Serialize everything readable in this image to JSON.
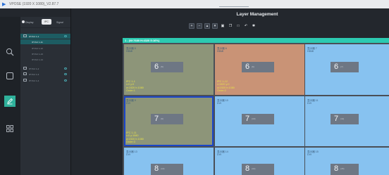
{
  "window": {
    "title": "VPOSE (1920 X 1080)_V2.87.7"
  },
  "header": {
    "mode_labels": [
      "Display",
      "IPC",
      "Signal"
    ]
  },
  "tree": {
    "items": [
      {
        "label": "IP Port 1-1",
        "level": 0,
        "selected": true
      },
      {
        "label": "IP Port 1-11",
        "level": 1,
        "selected": true
      },
      {
        "label": "IP Port 1-12",
        "level": 1,
        "selected": false
      },
      {
        "label": "IP Port 1-13",
        "level": 1,
        "selected": false
      },
      {
        "label": "IP Port 1-14",
        "level": 1,
        "selected": false
      },
      {
        "label": "IP Port 1-2",
        "level": 0,
        "selected": false
      },
      {
        "label": "IP Port 1-3",
        "level": 0,
        "selected": false
      },
      {
        "label": "IP Port 1-4",
        "level": 0,
        "selected": false
      }
    ]
  },
  "main": {
    "title": "Layer Management",
    "toolbar": [
      "plus-icon",
      "minus-icon",
      "layer-up-icon",
      "layer-down-icon",
      "fit-icon",
      "copy-icon",
      "paste-icon",
      "undo-icon",
      "settings-icon"
    ],
    "canvas_header": "1 - (W:7680 H:4320 5:16%)",
    "cells": [
      {
        "name": "显示器 5",
        "port": "HDMI",
        "number": "6",
        "sub": "(5)",
        "bg": "#8d9579",
        "info": [
          "IPC 1-1",
          "x:0 y:0",
          "w:1920 h:1080",
          "Order:1"
        ]
      },
      {
        "name": "显示器 6",
        "port": "HDMI",
        "number": "6",
        "sub": "(6)",
        "bg": "#c99376",
        "info": [
          "IPC 1-12",
          "x:1920 y:0",
          "w:1920 h:1080",
          "Order:2"
        ]
      },
      {
        "name": "显示器 7",
        "port": "HDMI",
        "number": "6",
        "sub": "(7)",
        "bg": "#87c2f0",
        "info": []
      },
      {
        "name": "显示器 9",
        "port": "DVI",
        "number": "7",
        "sub": "(9)",
        "bg": "#8d9579",
        "info": [
          "IPC 1-11",
          "x:0 y:1080",
          "w:1920 h:1080",
          "Order:3"
        ]
      },
      {
        "name": "显示器 10",
        "port": "DVI",
        "number": "7",
        "sub": "(10)",
        "bg": "#87c2f0",
        "info": []
      },
      {
        "name": "显示器 11",
        "port": "DVI",
        "number": "7",
        "sub": "(11)",
        "bg": "#87c2f0",
        "info": []
      },
      {
        "name": "显示器 13",
        "port": "DVI",
        "number": "8",
        "sub": "(13)",
        "bg": "#87c2f0",
        "info": []
      },
      {
        "name": "显示器 14",
        "port": "DVI",
        "number": "8",
        "sub": "(14)",
        "bg": "#87c2f0",
        "info": []
      },
      {
        "name": "显示器 15",
        "port": "DVI",
        "number": "8",
        "sub": "(15)",
        "bg": "#87c2f0",
        "info": []
      }
    ]
  },
  "colors": {
    "canvas_header": "#2ccab1",
    "selection_border": "#1b46c9",
    "info_text": "#e6e04a"
  }
}
